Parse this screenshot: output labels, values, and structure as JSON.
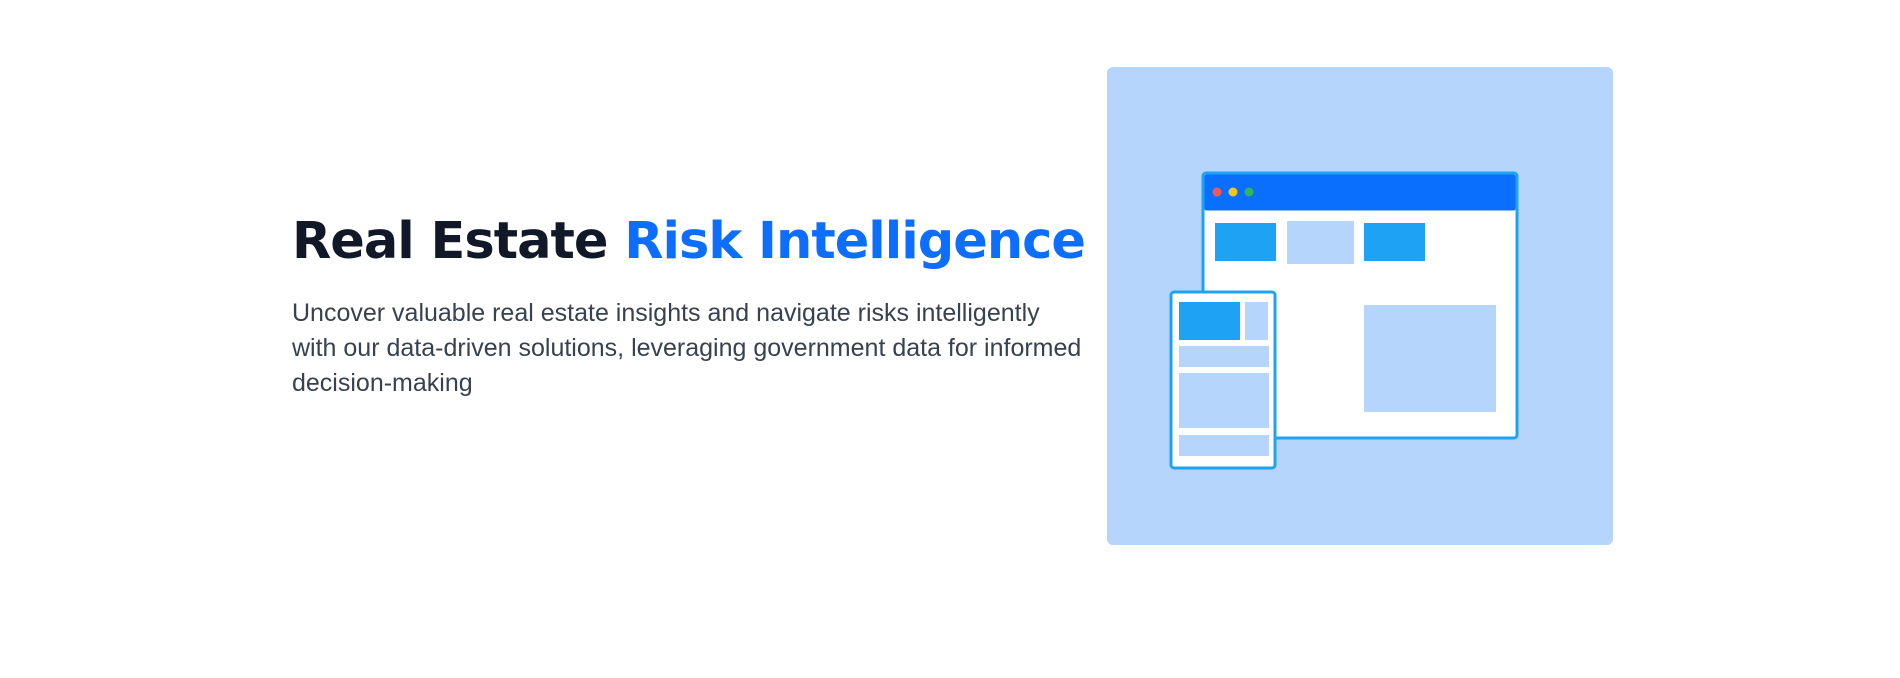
{
  "hero": {
    "headline_primary": "Real Estate",
    "headline_accent": "Risk Intelligence",
    "subtext": "Uncover valuable real estate insights and navigate risks intelligently with our data-driven solutions, leveraging government data for informed decision-making"
  },
  "colors": {
    "headline": "#111827",
    "accent": "#0d6efd",
    "body_text": "#374151",
    "illustration_background": "#b6d5fd",
    "window_titlebar": "#0b6ffd",
    "block_primary": "#1ea3f4",
    "block_light": "#b6d5fd",
    "window_outline": "#1ea3f4",
    "dot_red": "#f25a5a",
    "dot_yellow": "#f5c518",
    "dot_green": "#2fb55a"
  },
  "illustration": {
    "desktop_window_icon": "browser-window-icon",
    "mobile_window_icon": "mobile-screen-icon"
  }
}
